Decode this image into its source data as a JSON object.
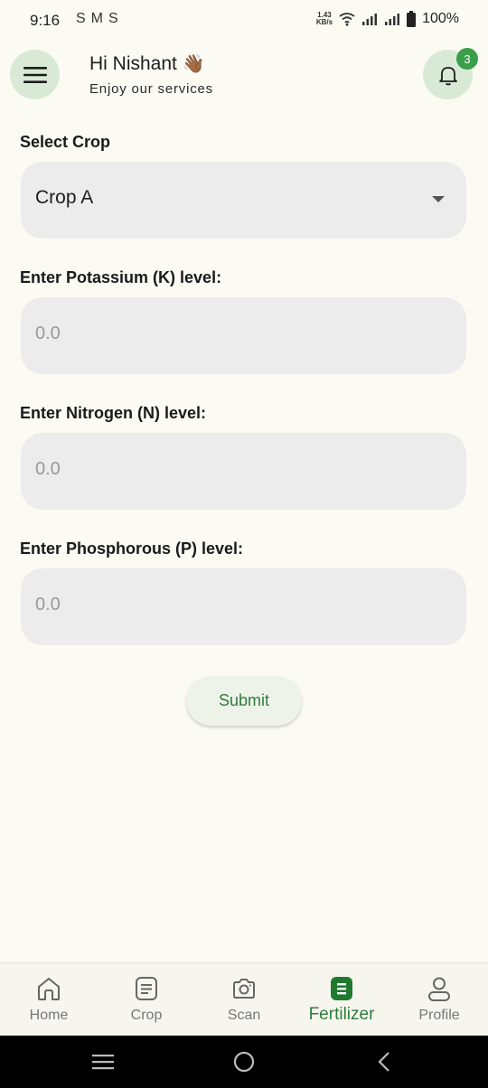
{
  "status_bar": {
    "time": "9:16",
    "app_icons": [
      "S",
      "M",
      "S"
    ],
    "net_speed_value": "1.43",
    "net_speed_unit": "KB/s",
    "battery": "100%"
  },
  "header": {
    "greeting": "Hi Nishant",
    "greeting_emoji": "👋🏾",
    "subtitle": "Enjoy our services",
    "notification_count": "3"
  },
  "form": {
    "crop_label": "Select Crop",
    "crop_selected": "Crop A",
    "potassium_label": "Enter Potassium (K) level:",
    "potassium_placeholder": "0.0",
    "nitrogen_label": "Enter Nitrogen (N) level:",
    "nitrogen_placeholder": "0.0",
    "phosphorous_label": "Enter Phosphorous (P) level:",
    "phosphorous_placeholder": "0.0",
    "submit_label": "Submit"
  },
  "bottom_nav": {
    "items": [
      {
        "label": "Home",
        "icon": "home-icon"
      },
      {
        "label": "Crop",
        "icon": "crop-icon"
      },
      {
        "label": "Scan",
        "icon": "camera-icon"
      },
      {
        "label": "Fertilizer",
        "icon": "fertilizer-icon",
        "active": true
      },
      {
        "label": "Profile",
        "icon": "profile-icon"
      }
    ]
  },
  "colors": {
    "background": "#fbfbf4",
    "accent_green": "#2d7d3a",
    "pill_green": "#d8ead5",
    "badge_green": "#3c9e4a",
    "field_gray": "#ececec"
  }
}
